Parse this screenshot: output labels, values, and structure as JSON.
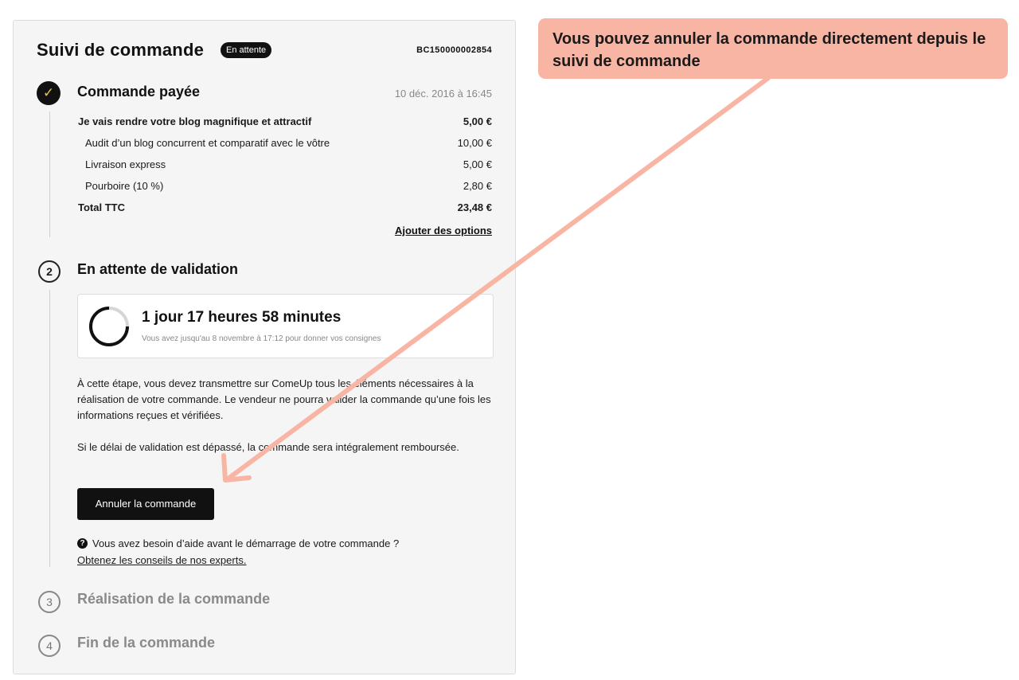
{
  "header": {
    "title": "Suivi de commande",
    "status_badge": "En attente",
    "order_ref": "BC150000002854"
  },
  "step1": {
    "title": "Commande payée",
    "date": "10 déc. 2016 à 16:45",
    "lines": [
      {
        "label": "Je vais rendre votre blog magnifique et attractif",
        "amount": "5,00 €"
      },
      {
        "label": "Audit d’un blog concurrent et comparatif avec le vôtre",
        "amount": "10,00 €"
      },
      {
        "label": "Livraison express",
        "amount": "5,00 €"
      },
      {
        "label": "Pourboire (10 %)",
        "amount": "2,80 €"
      },
      {
        "label": "Total TTC",
        "amount": "23,48 €"
      }
    ],
    "add_options_link": "Ajouter des options"
  },
  "step2": {
    "number": "2",
    "title": "En attente de validation",
    "timer": {
      "countdown": "1 jour 17 heures 58 minutes",
      "deadline_text": "Vous avez jusqu'au 8 novembre à 17:12 pour donner vos consignes"
    },
    "paragraph1": "À cette étape, vous devez transmettre sur ComeUp tous les éléments nécessaires à la réalisation de votre commande. Le vendeur ne pourra valider la commande qu’une fois les informations reçues et vérifiées.",
    "paragraph2": "Si le délai de validation est dépassé, la commande sera intégralement remboursée.",
    "cancel_button": "Annuler la commande",
    "help_text": "Vous avez besoin d’aide avant le démarrage de votre commande ?",
    "help_link": "Obtenez les conseils de nos experts."
  },
  "step3": {
    "number": "3",
    "title": "Réalisation de la commande"
  },
  "step4": {
    "number": "4",
    "title": "Fin de la commande"
  },
  "annotation": {
    "callout_text": "Vous pouvez annuler la commande directement depuis le suivi de commande"
  },
  "colors": {
    "accent": "#111111",
    "callout_bg": "#f9b5a4",
    "arrow": "#f9b5a4",
    "check_mark": "#e5c547"
  },
  "icons": {
    "step1": "check-icon",
    "timer": "progress-ring-icon",
    "help": "question-circle-icon"
  }
}
